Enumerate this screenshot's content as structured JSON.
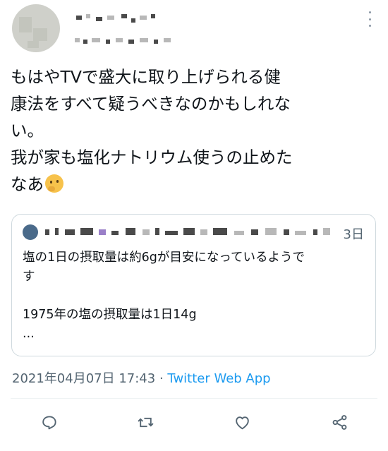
{
  "tweet": {
    "lines": [
      "もはやTVで盛大に取り上げられる健",
      "康法をすべて疑うべきなのかもしれな",
      "い。",
      "我が家も塩化ナトリウム使うの止めた",
      "なあ"
    ],
    "emoji": "thinking-face-emoji"
  },
  "quote": {
    "time": "3日",
    "lines": [
      "塩の1日の摂取量は約6gが目安になっているようで",
      "す",
      "",
      "1975年の塩の摂取量は1日14g",
      "..."
    ]
  },
  "meta": {
    "timestamp": "2021年04月07日 17:43",
    "separator": "·",
    "via": "Twitter Web App"
  },
  "actions": [
    "reply-icon",
    "retweet-icon",
    "like-icon",
    "share-icon"
  ],
  "colors": {
    "text": "#0f1419",
    "secondary": "#536471",
    "link": "#1d9bf0",
    "border": "#cfd9de",
    "icon": "#536471"
  }
}
